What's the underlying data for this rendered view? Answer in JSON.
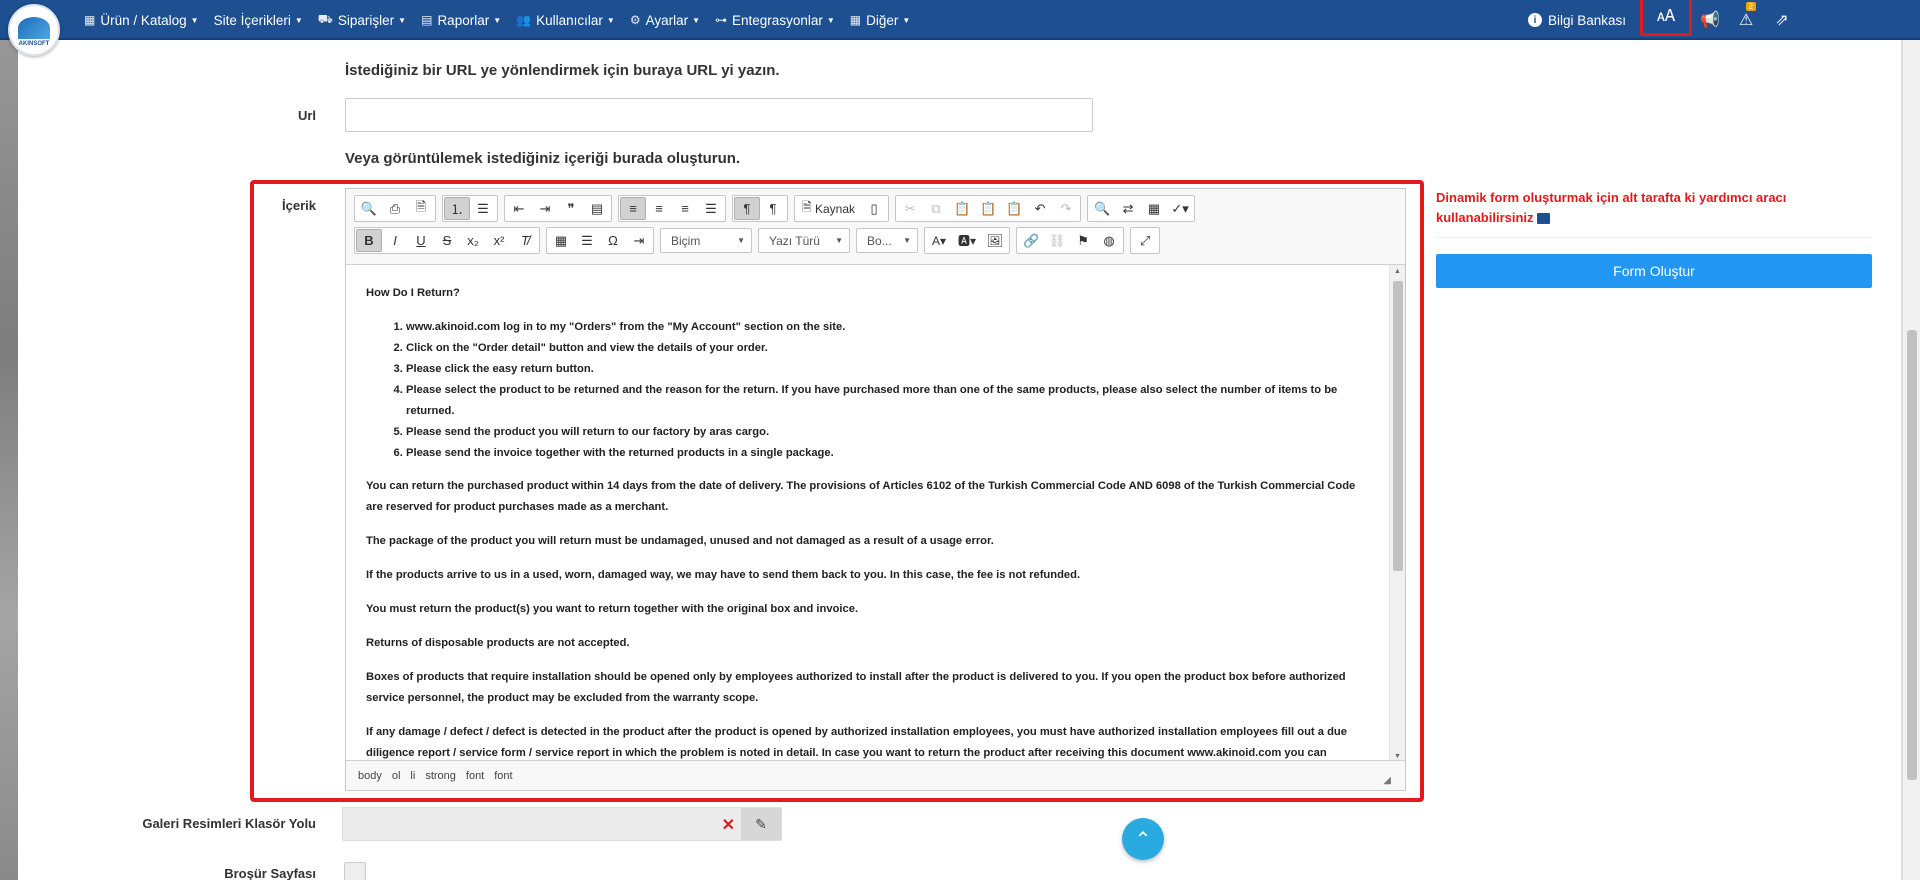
{
  "nav": {
    "menu": [
      {
        "label": "Ürün / Katalog",
        "icon": "cubes-icon"
      },
      {
        "label": "Site İçerikleri",
        "icon": "none"
      },
      {
        "label": "Siparişler",
        "icon": "truck-icon"
      },
      {
        "label": "Raporlar",
        "icon": "report-icon"
      },
      {
        "label": "Kullanıcılar",
        "icon": "users-icon"
      },
      {
        "label": "Ayarlar",
        "icon": "gears-icon"
      },
      {
        "label": "Entegrasyonlar",
        "icon": "sitemap-icon"
      },
      {
        "label": "Diğer",
        "icon": "grid-icon"
      }
    ],
    "bilgi": "Bilgi Bankası",
    "badge": "2",
    "logo_text": "AKINSOFT"
  },
  "form": {
    "url_heading": "İstediğiniz bir URL ye yönlendirmek için buraya URL yi yazın.",
    "url_label": "Url",
    "content_heading": "Veya görüntülemek istediğiniz içeriği burada oluşturun.",
    "content_label": "İçerik",
    "galeri_label": "Galeri Resimleri Klasör Yolu",
    "brosur_label": "Broşür Sayfası"
  },
  "editor": {
    "kaynak": "Kaynak",
    "combo_bicim": "Biçim",
    "combo_font": "Yazı Türü",
    "combo_size": "Bo...",
    "path": [
      "body",
      "ol",
      "li",
      "strong",
      "font",
      "font"
    ],
    "title": "How Do I Return?",
    "list": [
      "www.akinoid.com log in to my \"Orders\" from the \"My Account\" section on the site.",
      "Click on the \"Order detail\" button and view the details of your order.",
      "Please click the easy return button.",
      "Please select the product to be returned and the reason for the return. If you have purchased more than one of the same products, please also select the number of items to be returned.",
      "Please send the product you will return to our factory by aras cargo.",
      "Please send the invoice together with the returned products in a single package."
    ],
    "paragraphs": [
      "You can return the purchased product within 14 days from the date of delivery. The provisions of Articles 6102 of the Turkish Commercial Code AND 6098 of the Turkish Commercial Code are reserved for product purchases made as a merchant.",
      "The package of the product you will return must be undamaged, unused and not damaged as a result of a usage error.",
      "If the products arrive to us in a used, worn, damaged way, we may have to send them back to you. In this case, the fee is not refunded.",
      "You must return the product(s) you want to return together with the original box and invoice.",
      "Returns of disposable products are not accepted.",
      "Boxes of products that require installation should be opened only by employees authorized to install after the product is delivered to you. If you open the product box before authorized service personnel, the product may be excluded from the warranty scope.",
      "If any damage / defect / defect is detected in the product after the product is opened by authorized installation employees, you must have authorized installation employees fill out a due diligence report / service form / service report in which the problem is noted in detail. In case you want to return the product after receiving this document www.akinoid.com you can"
    ]
  },
  "side": {
    "hint": "Dinamik form oluşturmak için alt tarafta ki yardımcı aracı kullanabilirsiniz",
    "form_button": "Form Oluştur"
  }
}
